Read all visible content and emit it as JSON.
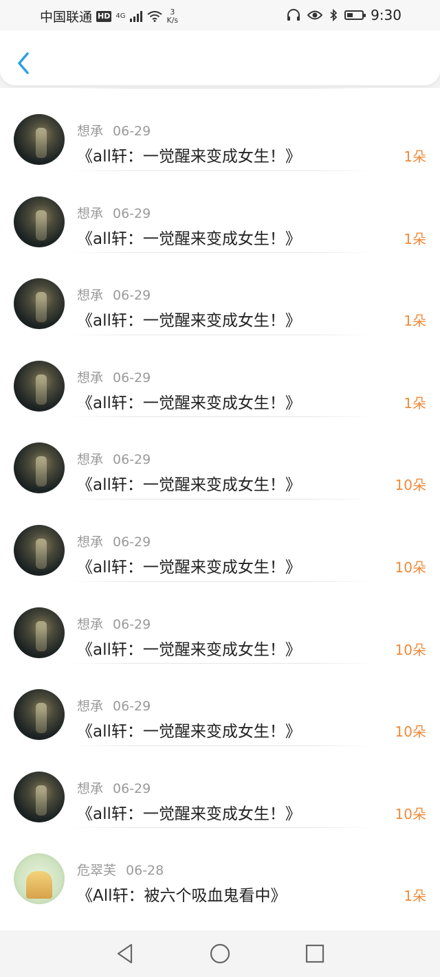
{
  "status_bar": {
    "carrier": "中国联通",
    "hd": "HD",
    "network": "4G",
    "speed_value": "3",
    "speed_unit": "K/s",
    "time": "9:30"
  },
  "header": {
    "back_icon": "chevron-left-icon"
  },
  "colors": {
    "accent": "#ef8a3a",
    "back": "#2aa0e8"
  },
  "items": [
    {
      "user": "想承",
      "date": "06-29",
      "title": "《all轩：一觉醒来变成女生！》",
      "amount": "1朵"
    },
    {
      "user": "想承",
      "date": "06-29",
      "title": "《all轩：一觉醒来变成女生！》",
      "amount": "1朵"
    },
    {
      "user": "想承",
      "date": "06-29",
      "title": "《all轩：一觉醒来变成女生！》",
      "amount": "1朵"
    },
    {
      "user": "想承",
      "date": "06-29",
      "title": "《all轩：一觉醒来变成女生！》",
      "amount": "1朵"
    },
    {
      "user": "想承",
      "date": "06-29",
      "title": "《all轩：一觉醒来变成女生！》",
      "amount": "10朵"
    },
    {
      "user": "想承",
      "date": "06-29",
      "title": "《all轩：一觉醒来变成女生！》",
      "amount": "10朵"
    },
    {
      "user": "想承",
      "date": "06-29",
      "title": "《all轩：一觉醒来变成女生！》",
      "amount": "10朵"
    },
    {
      "user": "想承",
      "date": "06-29",
      "title": "《all轩：一觉醒来变成女生！》",
      "amount": "10朵"
    },
    {
      "user": "想承",
      "date": "06-29",
      "title": "《all轩：一觉醒来变成女生！》",
      "amount": "10朵"
    },
    {
      "user": "危翠芙",
      "date": "06-28",
      "title": "《All轩：被六个吸血鬼看中》",
      "amount": "1朵"
    }
  ],
  "nav": {
    "back": "triangle-back-icon",
    "home": "circle-home-icon",
    "recent": "square-recent-icon"
  }
}
